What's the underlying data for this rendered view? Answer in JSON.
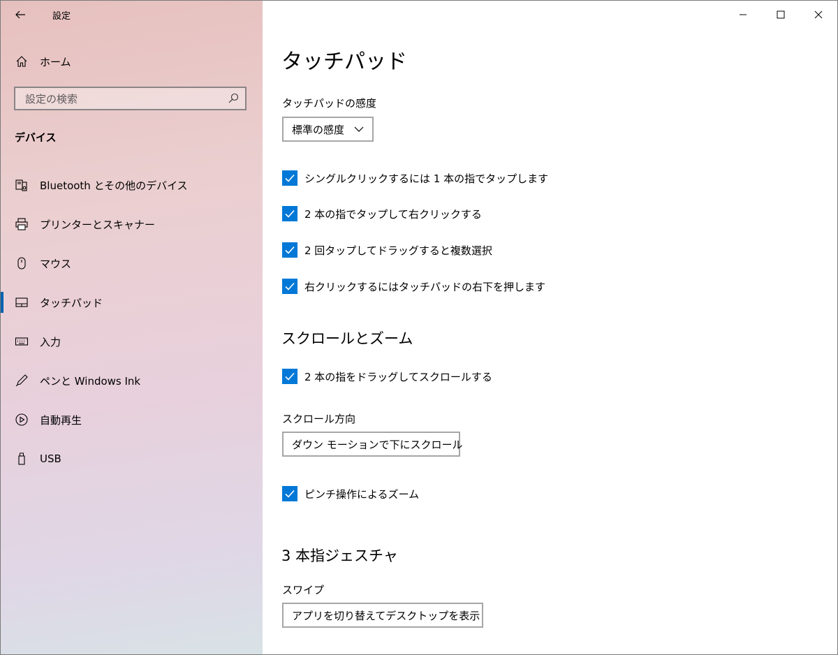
{
  "window": {
    "app_title": "設定",
    "controls": [
      "minimize-icon",
      "maximize-icon",
      "close-icon"
    ]
  },
  "sidebar": {
    "home_label": "ホーム",
    "search_placeholder": "設定の検索",
    "section": "デバイス",
    "items": [
      {
        "label": "Bluetooth とその他のデバイス",
        "icon": "bluetooth-devices-icon"
      },
      {
        "label": "プリンターとスキャナー",
        "icon": "printer-icon"
      },
      {
        "label": "マウス",
        "icon": "mouse-icon"
      },
      {
        "label": "タッチパッド",
        "icon": "touchpad-icon",
        "active": true
      },
      {
        "label": "入力",
        "icon": "keyboard-icon"
      },
      {
        "label": "ペンと Windows Ink",
        "icon": "pen-icon"
      },
      {
        "label": "自動再生",
        "icon": "autoplay-icon"
      },
      {
        "label": "USB",
        "icon": "usb-icon"
      }
    ]
  },
  "main": {
    "title": "タッチパッド",
    "sensitivity": {
      "label": "タッチパッドの感度",
      "value": "標準の感度"
    },
    "taps": [
      {
        "label": "シングルクリックするには 1 本の指でタップします",
        "checked": true
      },
      {
        "label": "2 本の指でタップして右クリックする",
        "checked": true
      },
      {
        "label": "2 回タップしてドラッグすると複数選択",
        "checked": true
      },
      {
        "label": "右クリックするにはタッチパッドの右下を押します",
        "checked": true
      }
    ],
    "scroll_zoom": {
      "title": "スクロールとズーム",
      "drag_scroll": {
        "label": "2 本の指をドラッグしてスクロールする",
        "checked": true
      },
      "direction": {
        "label": "スクロール方向",
        "value": "ダウン モーションで下にスクロール"
      },
      "pinch": {
        "label": "ピンチ操作によるズーム",
        "checked": true
      }
    },
    "three_finger": {
      "title": "3 本指ジェスチャ",
      "swipe": {
        "label": "スワイプ",
        "value": "アプリを切り替えてデスクトップを表示"
      }
    }
  },
  "colors": {
    "accent": "#0078d7",
    "active_indicator": "#0063b1"
  }
}
